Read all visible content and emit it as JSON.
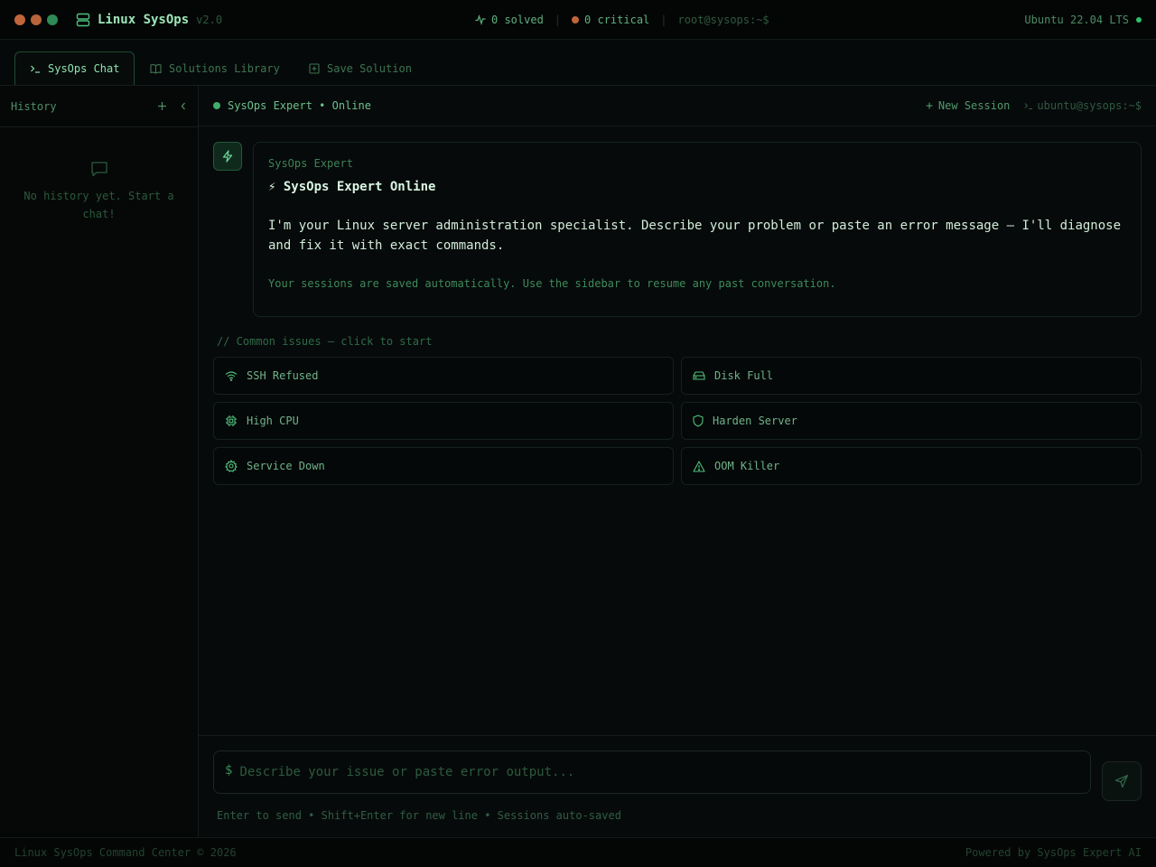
{
  "colors": {
    "accent": "#3fae6a",
    "dot_red": "#c1663a",
    "dot_orange": "#c1663a",
    "dot_green": "#2f8a55",
    "critical": "#c1663a",
    "background": "#070a0b"
  },
  "app": {
    "name": "Linux SysOps",
    "version": "v2.0",
    "logo_icon": "server-icon"
  },
  "topbar": {
    "solved": "0 solved",
    "critical": "0 critical",
    "prompt": "root@sysops:~$",
    "os": "Ubuntu 22.04 LTS"
  },
  "tabs": [
    {
      "label": "SysOps Chat",
      "icon": "terminal-icon",
      "active": true
    },
    {
      "label": "Solutions Library",
      "icon": "book-icon",
      "active": false
    },
    {
      "label": "Save Solution",
      "icon": "save-icon",
      "active": false
    }
  ],
  "sidebar": {
    "title": "History",
    "empty_text": "No history yet. Start a chat!"
  },
  "chat": {
    "status": "SysOps Expert • Online",
    "new_session": "New Session",
    "prompt": "ubuntu@sysops:~$",
    "message": {
      "sender": "SysOps Expert",
      "title": "⚡ SysOps Expert Online",
      "body": "I'm your Linux server administration specialist. Describe your problem or paste an error message — I'll diagnose and fix it with exact commands.",
      "note": "Your sessions are saved automatically. Use the sidebar to resume any past conversation."
    },
    "common_label": "// Common issues — click to start",
    "issues": [
      {
        "label": "SSH Refused",
        "icon": "wifi-icon"
      },
      {
        "label": "Disk Full",
        "icon": "hard-drive-icon"
      },
      {
        "label": "High CPU",
        "icon": "cpu-icon"
      },
      {
        "label": "Harden Server",
        "icon": "shield-icon"
      },
      {
        "label": "Service Down",
        "icon": "gear-icon"
      },
      {
        "label": "OOM Killer",
        "icon": "warning-icon"
      }
    ]
  },
  "composer": {
    "prefix": "$",
    "placeholder": "Describe your issue or paste error output...",
    "hint": "Enter to send • Shift+Enter for new line • Sessions auto-saved"
  },
  "footer": {
    "left": "Linux SysOps Command Center © 2026",
    "right": "Powered by SysOps Expert AI"
  }
}
